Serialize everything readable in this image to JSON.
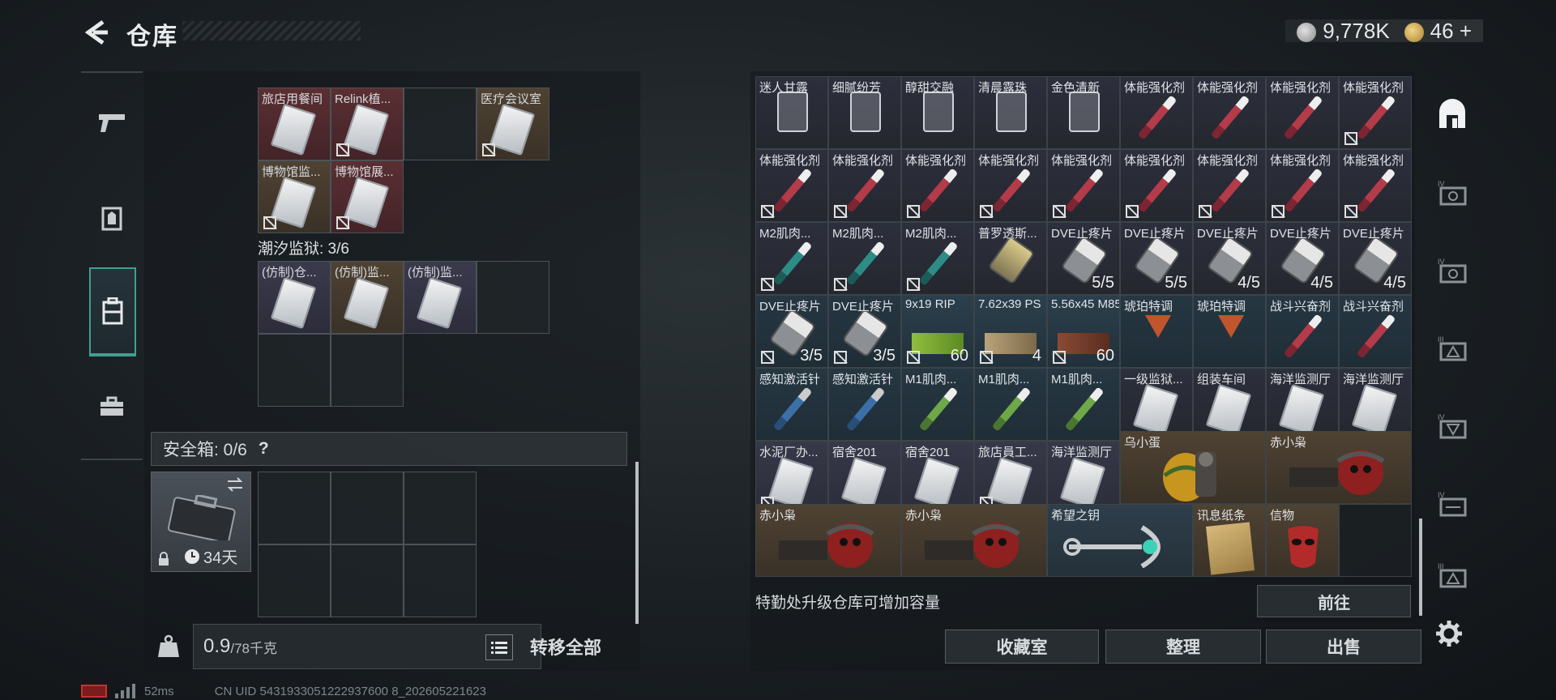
{
  "header": {
    "title": "仓库",
    "currency_silver": "9,778K",
    "currency_gold": "46"
  },
  "left": {
    "top_slots": [
      {
        "label": "旅店用餐间"
      },
      {
        "label": "Relink植..."
      },
      {
        "label": ""
      },
      {
        "label": "医疗会议室"
      },
      {
        "label": "博物馆监..."
      },
      {
        "label": "博物馆展..."
      }
    ],
    "tide_prison_label": "潮汐监狱: 3/6",
    "tide_slots": [
      {
        "label": "(仿制)仓..."
      },
      {
        "label": "(仿制)监..."
      },
      {
        "label": "(仿制)监..."
      }
    ],
    "safe_title": "安全箱: 0/6",
    "safe_help": "?",
    "safe_days": "34天",
    "weight_value": "0.9",
    "weight_max": "/78千克",
    "transfer_all": "转移全部"
  },
  "right": {
    "cells": [
      {
        "label": "迷人甘露",
        "count": ""
      },
      {
        "label": "细腻纷芳",
        "count": ""
      },
      {
        "label": "醇甜交融",
        "count": ""
      },
      {
        "label": "清晨露珠",
        "count": ""
      },
      {
        "label": "金色清新",
        "count": ""
      },
      {
        "label": "体能强化剂",
        "count": ""
      },
      {
        "label": "体能强化剂",
        "count": ""
      },
      {
        "label": "体能强化剂",
        "count": ""
      },
      {
        "label": "体能强化剂",
        "count": ""
      },
      {
        "label": "体能强化剂",
        "count": ""
      },
      {
        "label": "体能强化剂",
        "count": ""
      },
      {
        "label": "体能强化剂",
        "count": ""
      },
      {
        "label": "体能强化剂",
        "count": ""
      },
      {
        "label": "体能强化剂",
        "count": ""
      },
      {
        "label": "体能强化剂",
        "count": ""
      },
      {
        "label": "体能强化剂",
        "count": ""
      },
      {
        "label": "体能强化剂",
        "count": ""
      },
      {
        "label": "体能强化剂",
        "count": ""
      },
      {
        "label": "M2肌肉...",
        "count": ""
      },
      {
        "label": "M2肌肉...",
        "count": ""
      },
      {
        "label": "M2肌肉...",
        "count": ""
      },
      {
        "label": "普罗透斯...",
        "count": ""
      },
      {
        "label": "DVE止疼片",
        "count": "5/5"
      },
      {
        "label": "DVE止疼片",
        "count": "5/5"
      },
      {
        "label": "DVE止疼片",
        "count": "4/5"
      },
      {
        "label": "DVE止疼片",
        "count": "4/5"
      },
      {
        "label": "DVE止疼片",
        "count": "4/5"
      },
      {
        "label": "DVE止疼片",
        "count": "3/5"
      },
      {
        "label": "DVE止疼片",
        "count": "3/5"
      },
      {
        "label": "9x19 RIP",
        "count": "60"
      },
      {
        "label": "7.62x39 PS",
        "count": "4"
      },
      {
        "label": "5.56x45 M855",
        "count": "60"
      },
      {
        "label": "琥珀特调",
        "count": ""
      },
      {
        "label": "琥珀特调",
        "count": ""
      },
      {
        "label": "战斗兴奋剂",
        "count": ""
      },
      {
        "label": "战斗兴奋剂",
        "count": ""
      },
      {
        "label": "感知激活针",
        "count": ""
      },
      {
        "label": "感知激活针",
        "count": ""
      },
      {
        "label": "M1肌肉...",
        "count": ""
      },
      {
        "label": "M1肌肉...",
        "count": ""
      },
      {
        "label": "M1肌肉...",
        "count": ""
      },
      {
        "label": "一级监狱...",
        "count": ""
      },
      {
        "label": "组装车间",
        "count": ""
      },
      {
        "label": "海洋监测厅",
        "count": ""
      },
      {
        "label": "海洋监测厅",
        "count": ""
      },
      {
        "label": "水泥厂办...",
        "count": ""
      },
      {
        "label": "宿舍201",
        "count": ""
      },
      {
        "label": "宿舍201",
        "count": ""
      },
      {
        "label": "旅店員工...",
        "count": ""
      },
      {
        "label": "海洋监测厅",
        "count": ""
      }
    ],
    "big_items": {
      "egg": "乌小蛋",
      "owl1": "赤小枭",
      "owl2": "赤小枭",
      "owl3": "赤小枭",
      "key": "希望之钥",
      "paper": "讯息纸条",
      "token": "信物"
    },
    "info_text": "特勤处升级仓库可增加容量",
    "goto": "前往",
    "btn_collection": "收藏室",
    "btn_sort": "整理",
    "btn_sell": "出售"
  },
  "status": {
    "ping": "52ms",
    "uid": "CN UID 5431933051222937600 8_202605221623"
  }
}
